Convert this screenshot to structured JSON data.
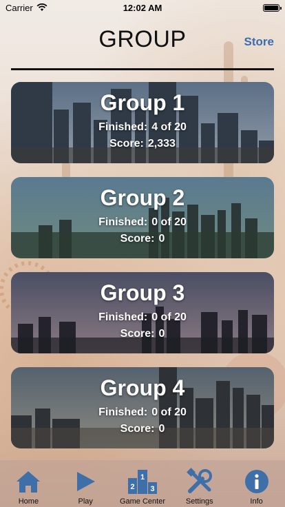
{
  "status": {
    "carrier": "Carrier",
    "time": "12:02 AM"
  },
  "nav": {
    "title": "GROUP",
    "store_label": "Store"
  },
  "finished_label": "Finished:",
  "score_label": "Score:",
  "groups": [
    {
      "title": "Group 1",
      "finished": "4 of 20",
      "score": "2,333"
    },
    {
      "title": "Group 2",
      "finished": "0 of 20",
      "score": "0"
    },
    {
      "title": "Group 3",
      "finished": "0 of 20",
      "score": "0"
    },
    {
      "title": "Group 4",
      "finished": "0 of 20",
      "score": "0"
    }
  ],
  "tabs": [
    {
      "label": "Home",
      "icon": "home-icon"
    },
    {
      "label": "Play",
      "icon": "play-icon"
    },
    {
      "label": "Game Center",
      "icon": "podium-icon"
    },
    {
      "label": "Settings",
      "icon": "tools-icon"
    },
    {
      "label": "Info",
      "icon": "info-icon"
    }
  ],
  "colors": {
    "accent": "#3a6db0",
    "icon": "#3f6fa8"
  }
}
